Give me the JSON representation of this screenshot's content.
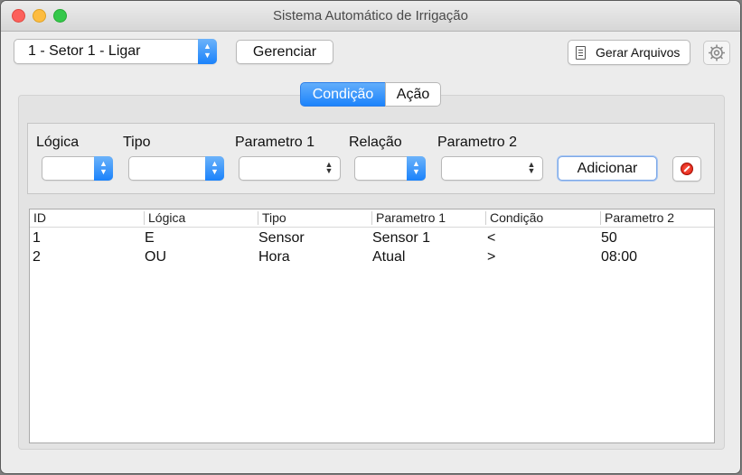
{
  "window": {
    "title": "Sistema Automático de Irrigação"
  },
  "toolbar": {
    "sector_select_value": "1 - Setor 1 - Ligar",
    "manage_label": "Gerenciar",
    "generate_files_label": "Gerar Arquivos",
    "settings_icon": "gear-icon"
  },
  "tabs": [
    {
      "label": "Condição",
      "selected": true
    },
    {
      "label": "Ação",
      "selected": false
    }
  ],
  "form": {
    "labels": {
      "logica": "Lógica",
      "tipo": "Tipo",
      "parametro1": "Parametro 1",
      "relacao": "Relação",
      "parametro2": "Parametro 2"
    },
    "values": {
      "logica": "",
      "tipo": "",
      "parametro1": "",
      "relacao": "",
      "parametro2": ""
    },
    "add_label": "Adicionar",
    "delete_icon": "stop-icon"
  },
  "table": {
    "columns": [
      "ID",
      "Lógica",
      "Tipo",
      "Parametro 1",
      "Condição",
      "Parametro 2"
    ],
    "rows": [
      [
        "1",
        "E",
        "Sensor",
        "Sensor 1",
        "<",
        "50"
      ],
      [
        "2",
        "OU",
        "Hora",
        "Atual",
        ">",
        "08:00"
      ]
    ]
  },
  "colors": {
    "accent": "#1a82fb",
    "window_bg": "#ececec",
    "close": "#fc605b",
    "minimize": "#fdbc40",
    "maximize": "#34c84a"
  }
}
